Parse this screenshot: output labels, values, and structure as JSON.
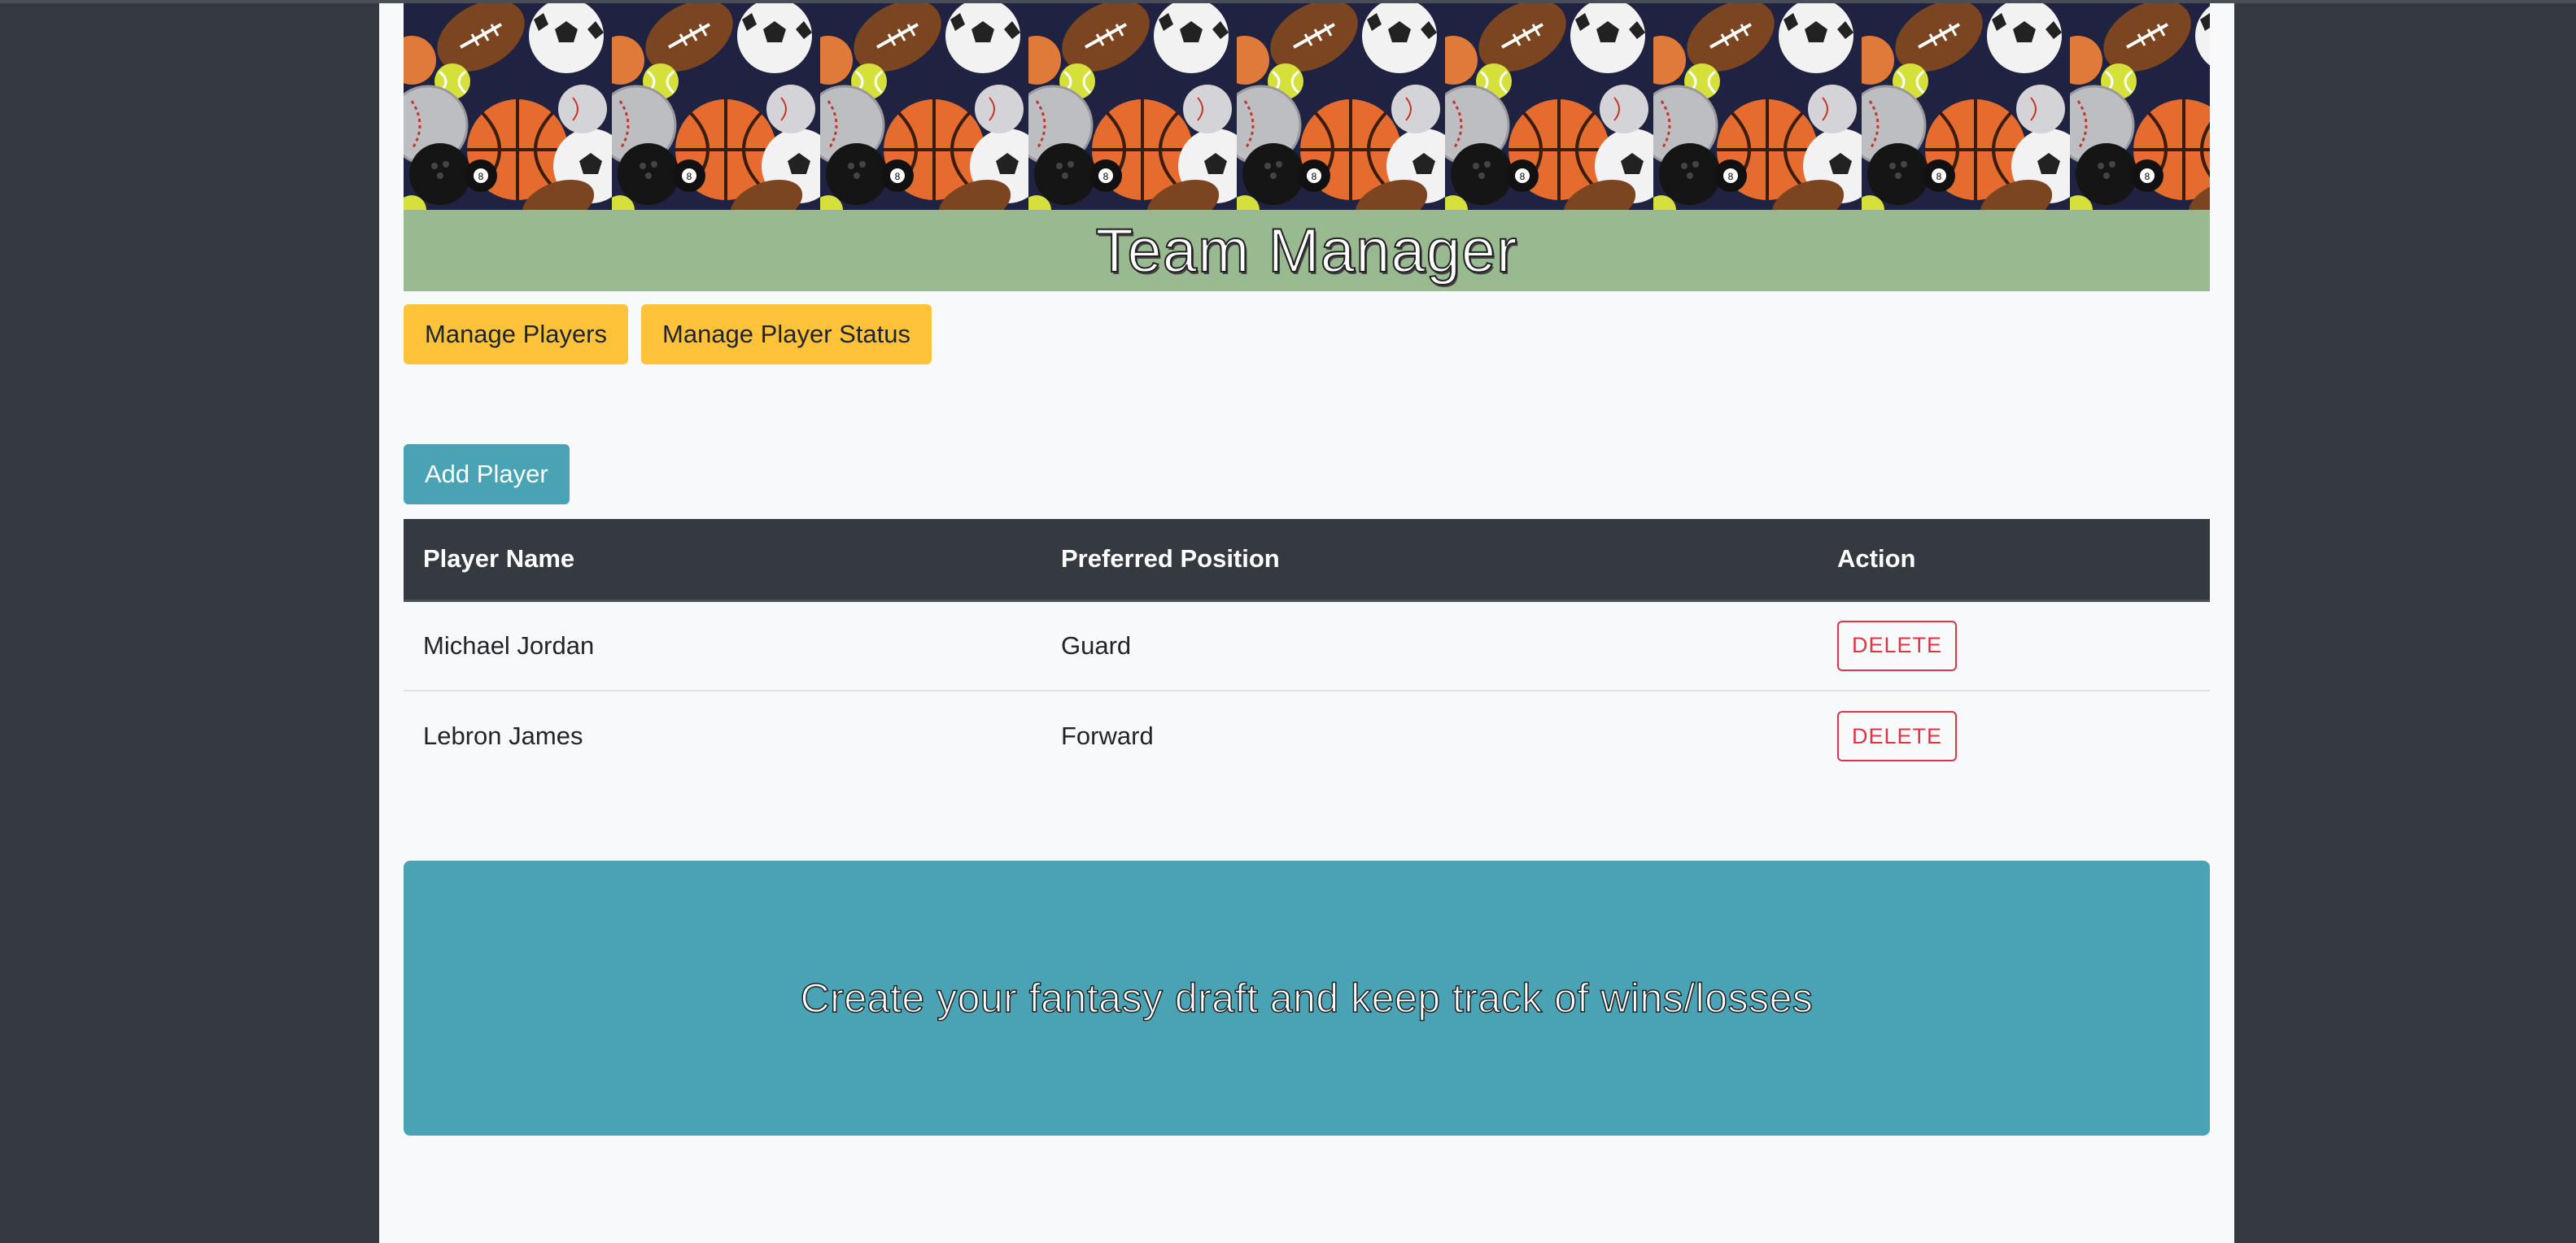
{
  "header": {
    "title": "Team Manager",
    "banner_icon": "sports-balls-pattern"
  },
  "nav": {
    "manage_players": "Manage Players",
    "manage_player_status": "Manage Player Status"
  },
  "actions": {
    "add_player": "Add Player"
  },
  "table": {
    "headers": [
      "Player Name",
      "Preferred Position",
      "Action"
    ],
    "rows": [
      {
        "name": "Michael Jordan",
        "position": "Guard",
        "action": "DELETE"
      },
      {
        "name": "Lebron James",
        "position": "Forward",
        "action": "DELETE"
      }
    ]
  },
  "jumbotron": {
    "text": "Create your fantasy draft and keep track of wins/losses"
  },
  "colors": {
    "page_bg": "#343a40",
    "content_bg": "#f8f9fa",
    "title_bar": "#99b990",
    "warning": "#ffc23b",
    "info": "#4aa3b4",
    "danger": "#dc3545",
    "table_header": "#343a40"
  }
}
